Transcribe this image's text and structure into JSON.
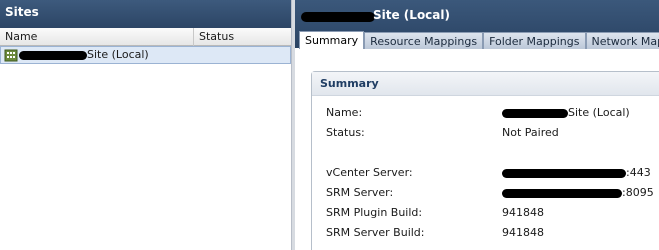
{
  "left_panel": {
    "title": "Sites",
    "columns": {
      "name": "Name",
      "status": "Status"
    },
    "sites": [
      {
        "label_suffix": "Site (Local)",
        "icon": "building-icon"
      }
    ]
  },
  "right_panel": {
    "title_suffix": "Site (Local)",
    "tabs": [
      "Summary",
      "Resource Mappings",
      "Folder Mappings",
      "Network Mappin"
    ],
    "summary": {
      "heading": "Summary",
      "name_label": "Name:",
      "name_value_suffix": "Site (Local)",
      "status_label": "Status:",
      "status_value": "Not Paired",
      "vcenter_label": "vCenter Server:",
      "vcenter_value_suffix": ":443",
      "srm_label": "SRM Server:",
      "srm_value_suffix": ":8095",
      "plugin_build_label": "SRM Plugin Build:",
      "plugin_build_value": "941848",
      "server_build_label": "SRM Server Build:",
      "server_build_value": "941848"
    }
  },
  "colors": {
    "header_bg": "#2f4b6e",
    "selection_bg": "#dde8f6",
    "redaction": "#000000"
  }
}
